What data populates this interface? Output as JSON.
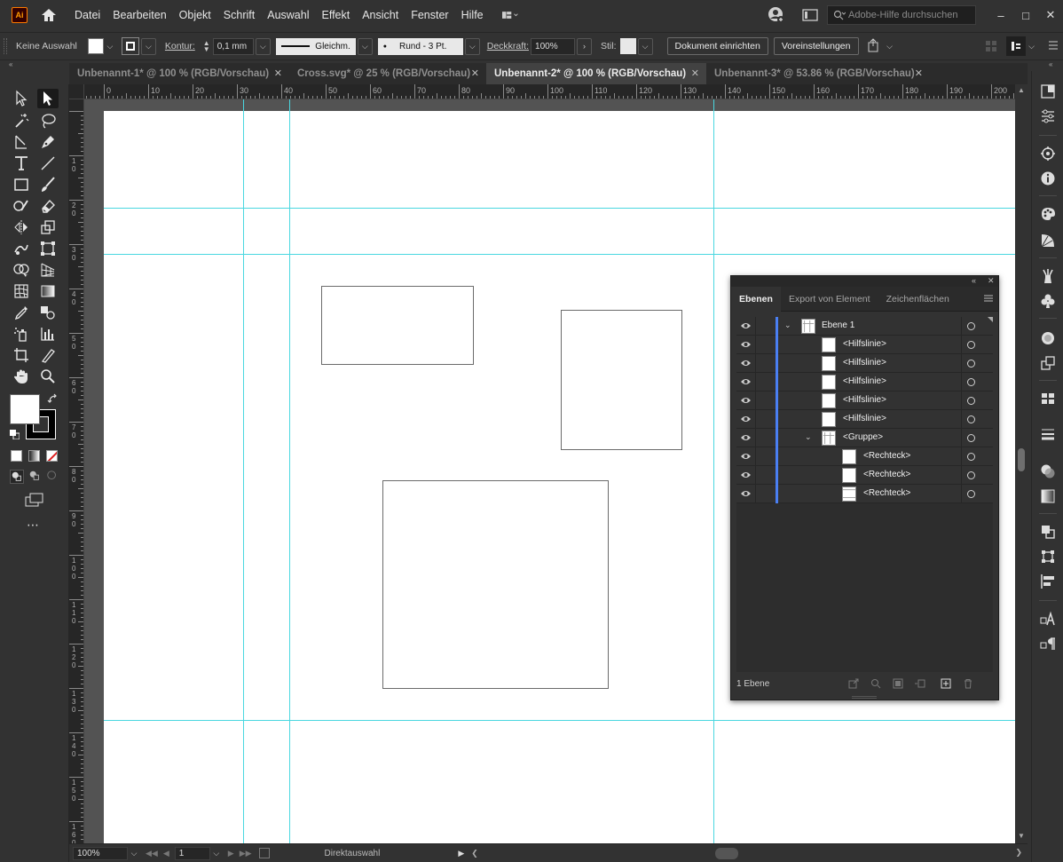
{
  "app": {
    "logo_text": "Ai"
  },
  "menu": {
    "items": [
      "Datei",
      "Bearbeiten",
      "Objekt",
      "Schrift",
      "Auswahl",
      "Effekt",
      "Ansicht",
      "Fenster",
      "Hilfe"
    ],
    "search_placeholder": "Adobe-Hilfe durchsuchen",
    "window_controls": [
      "–",
      "□",
      "✕"
    ]
  },
  "control_bar": {
    "selection_label": "Keine Auswahl",
    "stroke_label": "Kontur:",
    "stroke_weight": "0,1 mm",
    "stroke_profile": "Gleichm.",
    "brush": "Rund - 3 Pt.",
    "opacity_label": "Deckkraft:",
    "opacity_value": "100%",
    "style_label": "Stil:",
    "doc_setup_button": "Dokument einrichten",
    "prefs_button": "Voreinstellungen"
  },
  "tabs": [
    {
      "label": "Unbenannt-1* @ 100 % (RGB/Vorschau)",
      "active": false
    },
    {
      "label": "Cross.svg* @ 25 % (RGB/Vorschau)",
      "active": false
    },
    {
      "label": "Unbenannt-2* @ 100 % (RGB/Vorschau)",
      "active": true
    },
    {
      "label": "Unbenannt-3* @ 53.86 % (RGB/Vorschau)",
      "active": false
    }
  ],
  "tab_close": "✕",
  "ruler": {
    "h_labels": [
      "0",
      "10",
      "20",
      "30",
      "40",
      "50",
      "60",
      "70",
      "80",
      "90",
      "100",
      "110",
      "120",
      "130",
      "140",
      "150",
      "160",
      "170",
      "180",
      "190",
      "200"
    ],
    "v_labels": [
      "1",
      "0",
      "1",
      "0",
      "2",
      "0",
      "3",
      "0",
      "4",
      "0",
      "5",
      "0",
      "6",
      "0",
      "7",
      "0",
      "8",
      "0",
      "9",
      "0",
      "100",
      "110",
      "120",
      "130",
      "140",
      "150",
      "160"
    ]
  },
  "layers_panel": {
    "collapse_glyph": "«",
    "close_glyph": "✕",
    "tabs": [
      {
        "label": "Ebenen",
        "active": true
      },
      {
        "label": "Export von Element",
        "active": false
      },
      {
        "label": "Zeichenflächen",
        "active": false
      }
    ],
    "rows": [
      {
        "label": "Ebene 1",
        "depth": 0,
        "expanded": true,
        "thumb": "group",
        "bold": true
      },
      {
        "label": "<Hilfslinie>",
        "depth": 1,
        "thumb": "blank"
      },
      {
        "label": "<Hilfslinie>",
        "depth": 1,
        "thumb": "blank"
      },
      {
        "label": "<Hilfslinie>",
        "depth": 1,
        "thumb": "blank"
      },
      {
        "label": "<Hilfslinie>",
        "depth": 1,
        "thumb": "blank"
      },
      {
        "label": "<Hilfslinie>",
        "depth": 1,
        "thumb": "blank"
      },
      {
        "label": "<Gruppe>",
        "depth": 1,
        "expanded": true,
        "thumb": "group"
      },
      {
        "label": "<Rechteck>",
        "depth": 2,
        "thumb": "blank"
      },
      {
        "label": "<Rechteck>",
        "depth": 2,
        "thumb": "blank"
      },
      {
        "label": "<Rechteck>",
        "depth": 2,
        "thumb": "blank"
      }
    ],
    "layer_count": "1 Ebene"
  },
  "status_bar": {
    "zoom": "100%",
    "artboard_number": "1",
    "tool_name": "Direktauswahl"
  },
  "colors": {
    "guide": "#4ad7e0",
    "layer_color": "#4a7ff2",
    "accent_logo": "#ff9a00"
  }
}
